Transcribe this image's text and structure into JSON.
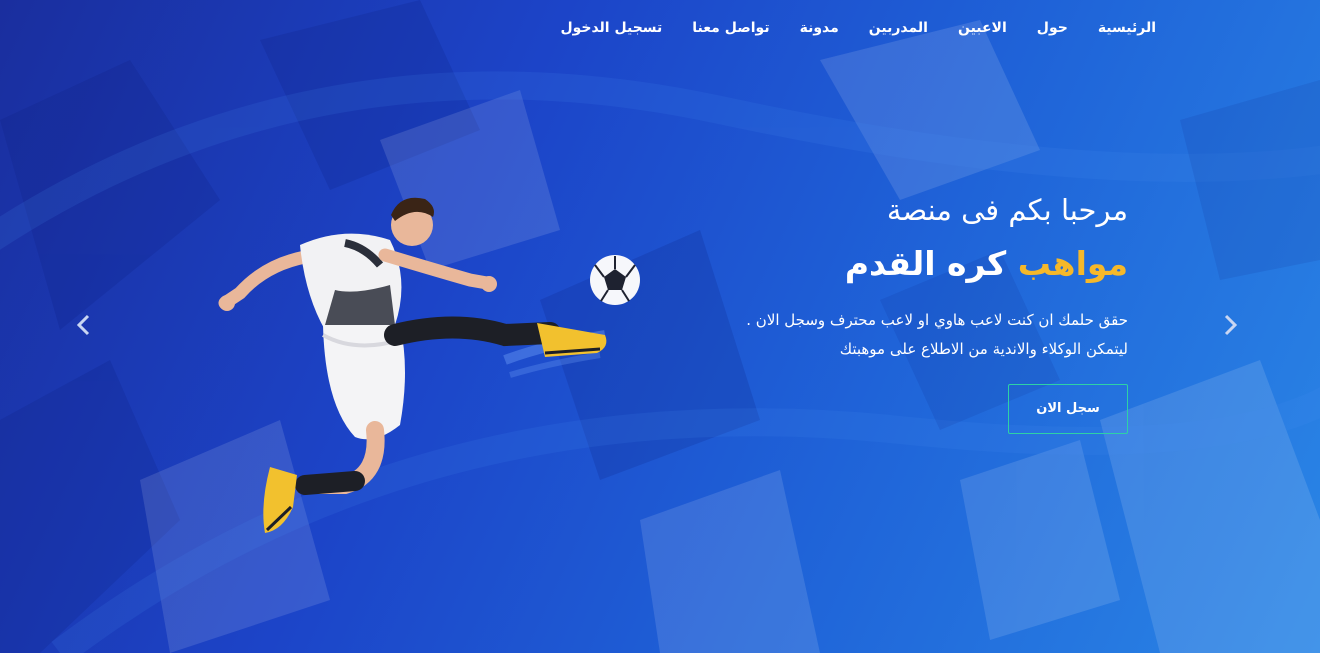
{
  "nav": {
    "items": [
      {
        "label": "الرئيسية"
      },
      {
        "label": "حول"
      },
      {
        "label": "الاعبين"
      },
      {
        "label": "المدربين"
      },
      {
        "label": "مدونة"
      },
      {
        "label": "تواصل معنا"
      },
      {
        "label": "تسجيل الدخول"
      }
    ]
  },
  "hero": {
    "subtitle": "مرحبا بكم فى منصة",
    "title_accent": "مواهب",
    "title_rest": "كره القدم",
    "desc_line1": "حقق حلمك ان كنت لاعب هاوي او لاعب محترف وسجل الان .",
    "desc_line2": "ليتمكن الوكلاء والاندية من الاطلاع على موهبتك",
    "cta_label": "سجل الان"
  },
  "icons": {
    "prev": "chevron-left-icon",
    "next": "chevron-right-icon"
  },
  "colors": {
    "accent": "#f5b82a",
    "button_border": "#2ed1a6",
    "bg_dark": "#1a2e9e",
    "bg_light": "#2a86e6"
  }
}
